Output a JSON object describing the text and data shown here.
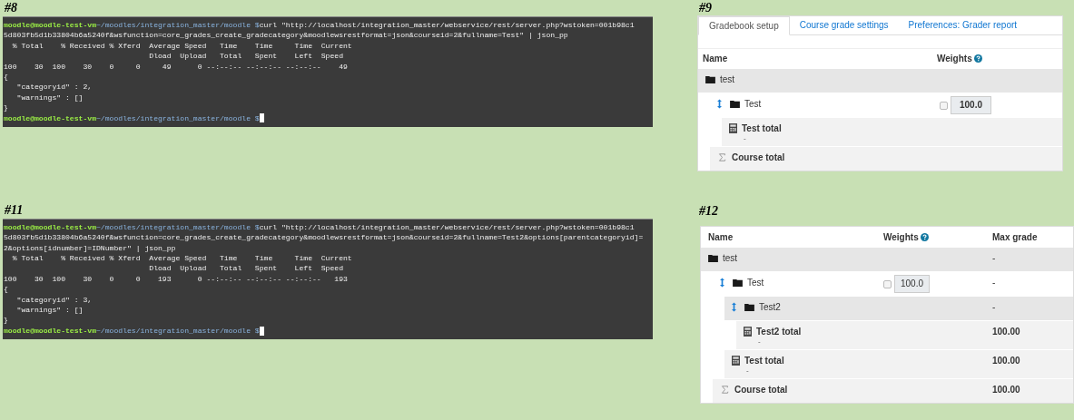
{
  "terminals": [
    {
      "label": "#8",
      "lines": [
        {
          "kind": "prompt",
          "user": "moodle@moodle-test-vm",
          "path": "~/moodles/integration_master/moodle $",
          "command": "curl \"http://localhost/integration_master/webservice/rest/server.php?wstoken=001b98c1"
        },
        {
          "kind": "output",
          "text": "5d803fb5d1b33804b6a5240f&wsfunction=core_grades_create_gradecategory&moodlewsrestformat=json&courseid=2&fullname=Test\" | json_pp"
        },
        {
          "kind": "output",
          "text": "  % Total    % Received % Xferd  Average Speed   Time    Time     Time  Current"
        },
        {
          "kind": "output",
          "text": "                                 Dload  Upload   Total   Spent    Left  Speed"
        },
        {
          "kind": "output",
          "text": "100    30  100    30    0     0     49      0 --:--:-- --:--:-- --:--:--    49"
        },
        {
          "kind": "output",
          "text": "{"
        },
        {
          "kind": "output",
          "text": "   \"categoryid\" : 2,"
        },
        {
          "kind": "output",
          "text": "   \"warnings\" : []"
        },
        {
          "kind": "output",
          "text": "}"
        },
        {
          "kind": "prompt",
          "user": "moodle@moodle-test-vm",
          "path": "~/moodles/integration_master/moodle $",
          "cursor": true
        }
      ]
    },
    {
      "label": "#11",
      "lines": [
        {
          "kind": "prompt",
          "user": "moodle@moodle-test-vm",
          "path": "~/moodles/integration_master/moodle $",
          "command": "curl \"http://localhost/integration_master/webservice/rest/server.php?wstoken=001b98c1"
        },
        {
          "kind": "output",
          "text": "5d803fb5d1b33804b6a5240f&wsfunction=core_grades_create_gradecategory&moodlewsrestformat=json&courseid=2&fullname=Test2&options[parentcategoryid]="
        },
        {
          "kind": "output",
          "text": "2&options[idnumber]=IDNumber\" | json_pp"
        },
        {
          "kind": "output",
          "text": "  % Total    % Received % Xferd  Average Speed   Time    Time     Time  Current"
        },
        {
          "kind": "output",
          "text": "                                 Dload  Upload   Total   Spent    Left  Speed"
        },
        {
          "kind": "output",
          "text": "100    30  100    30    0     0    193      0 --:--:-- --:--:-- --:--:--   193"
        },
        {
          "kind": "output",
          "text": "{"
        },
        {
          "kind": "output",
          "text": "   \"categoryid\" : 3,"
        },
        {
          "kind": "output",
          "text": "   \"warnings\" : []"
        },
        {
          "kind": "output",
          "text": "}"
        },
        {
          "kind": "prompt",
          "user": "moodle@moodle-test-vm",
          "path": "~/moodles/integration_master/moodle $",
          "cursor": true
        }
      ]
    }
  ],
  "gradebooks": [
    {
      "label": "#9",
      "tabs": [
        {
          "label": "Gradebook setup",
          "selected": true
        },
        {
          "label": "Course grade settings",
          "selected": false
        },
        {
          "label": "Preferences: Grader report",
          "selected": false
        }
      ],
      "columns": [
        {
          "label": "Name"
        },
        {
          "label": "Weights",
          "help": true
        }
      ],
      "rows": [
        {
          "kind": "category",
          "name": "test",
          "movable": false,
          "children": [
            {
              "kind": "category",
              "name": "Test",
              "movable": true,
              "weight": {
                "value": "100.0",
                "checked": false
              },
              "children": [
                {
                  "kind": "total",
                  "name": "Test total",
                  "note": "-"
                }
              ]
            },
            {
              "kind": "course_total",
              "name": "Course total"
            }
          ]
        }
      ]
    },
    {
      "label": "#12",
      "columns": [
        {
          "label": "Name"
        },
        {
          "label": "Weights",
          "help": true
        },
        {
          "label": "Max grade"
        }
      ],
      "rows": [
        {
          "kind": "category",
          "name": "test",
          "movable": false,
          "max_grade": "-",
          "children": [
            {
              "kind": "category",
              "name": "Test",
              "movable": true,
              "weight": {
                "value": "100.0",
                "checked": false
              },
              "max_grade": "-",
              "children": [
                {
                  "kind": "category",
                  "name": "Test2",
                  "movable": true,
                  "max_grade": "-",
                  "children": [
                    {
                      "kind": "total",
                      "name": "Test2 total",
                      "note": "-",
                      "max_grade": "100.00"
                    }
                  ]
                },
                {
                  "kind": "total",
                  "name": "Test total",
                  "note": "-",
                  "max_grade": "100.00"
                }
              ]
            },
            {
              "kind": "course_total",
              "name": "Course total",
              "max_grade": "100.00"
            }
          ]
        }
      ]
    }
  ]
}
